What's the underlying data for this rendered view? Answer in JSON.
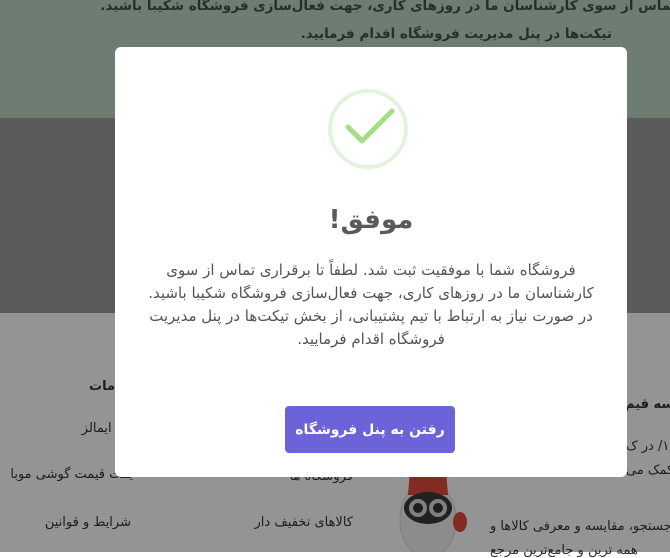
{
  "banner": {
    "line1": "تماس از سوی کارشناسان ما در روزهای کاری، جهت فعال‌سازی فروشگاه شکیبا باشید.",
    "line2": "تیکت‌ها در پنل مدیریت فروشگاه اقدام فرمایید."
  },
  "footer": {
    "heading_services": "مات",
    "heading_price": "سه قیم",
    "links": [
      "لله ایمالز",
      "یمت قیمت گوشی موبا",
      "شرایط و قوانین",
      "کالاهای تخفیف دار",
      "فروشگاه ها"
    ],
    "desc_lines": [
      "۱۳/ در ک",
      "ت کمک می",
      "جستجو، مقایسه و معرفی کالاها و",
      "همه ترین و جامع‌ترین مرجع"
    ]
  },
  "modal": {
    "icon": "checkmark-icon",
    "title": "موفق!",
    "message_p1": "فروشگاه شما با موفقیت ثبت شد. لطفاً تا برقراری تماس از سوی کارشناسان ما در روزهای کاری، جهت فعال‌سازی فروشگاه شکیبا باشید.",
    "message_p2": "در صورت نیاز به ارتباط با تیم پشتیبانی، از بخش تیکت‌ها در پنل مدیریت فروشگاه اقدام فرمایید.",
    "button_label": "رفتن به پنل فروشگاه"
  },
  "colors": {
    "button": "#6d63d8",
    "check": "#a5dc86",
    "banner": "#bcd8c4"
  }
}
